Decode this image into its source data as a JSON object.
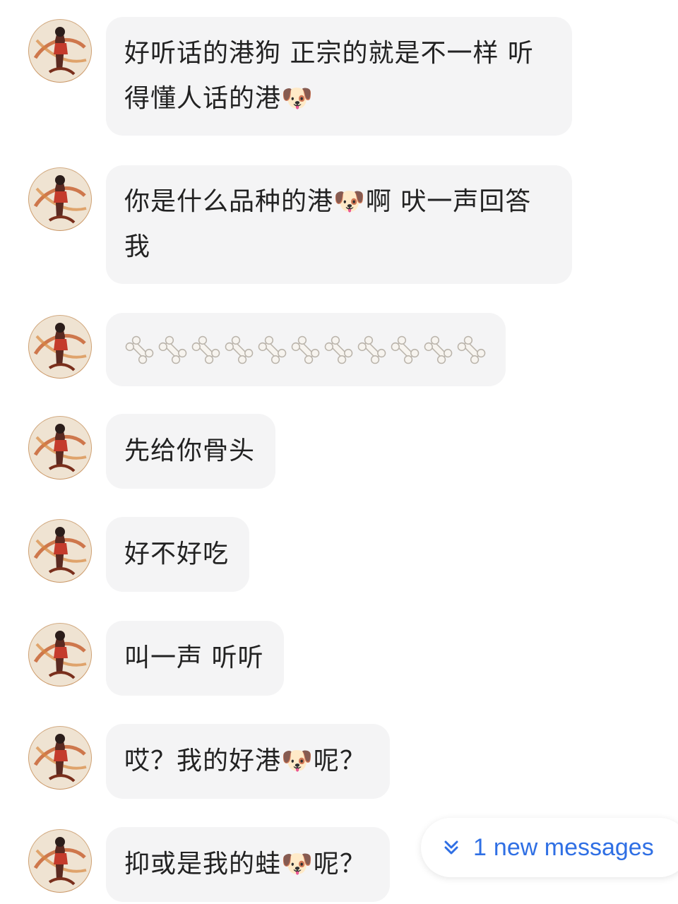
{
  "messages": [
    {
      "lines": [
        "好听话的港狗  正宗的就是不一样 听",
        "得懂人话的港🐶"
      ]
    },
    {
      "lines": [
        "你是什么品种的港🐶啊  吠一声回答",
        "我"
      ]
    },
    {
      "type": "bones",
      "count": 11,
      "icon": "bone-icon"
    },
    {
      "lines": [
        "先给你骨头"
      ]
    },
    {
      "lines": [
        "好不好吃"
      ]
    },
    {
      "lines": [
        "叫一声 听听"
      ]
    },
    {
      "lines": [
        "哎？我的好港🐶呢？"
      ]
    },
    {
      "lines": [
        "抑或是我的蛙🐶呢？"
      ]
    }
  ],
  "new_messages": {
    "count": "1",
    "label": "new messages",
    "icon": "double-chevron-down-icon",
    "color": "#2f6fe4"
  }
}
